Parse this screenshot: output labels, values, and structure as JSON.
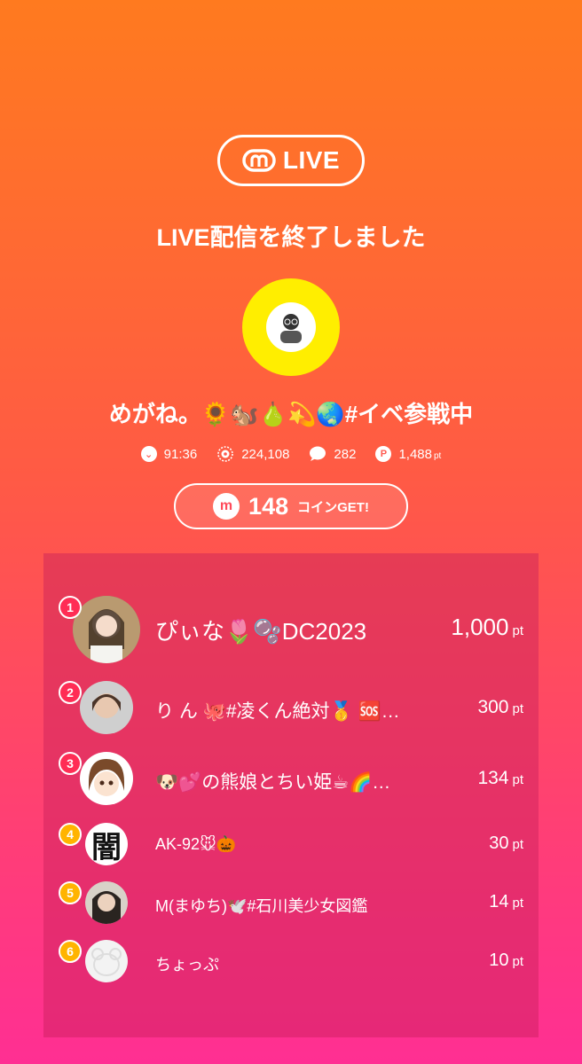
{
  "logo": {
    "text": "LIVE"
  },
  "title": "LIVE配信を終了しました",
  "host": {
    "name": "めがね。🌻🐿️🍐💫🌏#イベ参戦中"
  },
  "stats": {
    "duration": "91:36",
    "viewers": "224,108",
    "comments": "282",
    "points": "1,488",
    "points_unit": "pt"
  },
  "coins": {
    "amount": "148",
    "label": "コインGET!"
  },
  "ranking": [
    {
      "rank": "1",
      "name": "ぴぃな🌷🫧DC2023",
      "score": "1,000",
      "unit": "pt"
    },
    {
      "rank": "2",
      "name": "り ん 🐙#凌くん絶対🥇 🆘…",
      "score": "300",
      "unit": "pt"
    },
    {
      "rank": "3",
      "name": "🐶💕の熊娘とちい姫☕🌈…",
      "score": "134",
      "unit": "pt"
    },
    {
      "rank": "4",
      "name": "AK-92🐭🎃",
      "score": "30",
      "unit": "pt"
    },
    {
      "rank": "5",
      "name": "M(まゆち)🕊️#石川美少女図鑑",
      "score": "14",
      "unit": "pt"
    },
    {
      "rank": "6",
      "name": "ちょっぷ",
      "score": "10",
      "unit": "pt"
    }
  ],
  "avatar_text": {
    "rank4": "闇"
  },
  "colors": {
    "gradient_top": "#ff7a1f",
    "gradient_bottom": "#ff2f93",
    "badge_top3": "#ff2d55",
    "badge_other": "#ffb400",
    "host_avatar_bg": "#ffee00"
  }
}
